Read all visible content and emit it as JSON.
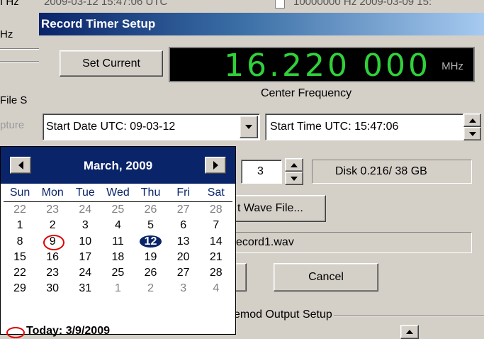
{
  "background": {
    "top_left_text": "I Hz",
    "top_mid_text": "2009-03-12 15:47:06 UTC",
    "top_right_text": "10000000 Hz   2009-03-09 15:",
    "left_labels": [
      "Hz",
      "File S",
      "pture"
    ]
  },
  "dialog": {
    "title": "Record Timer Setup",
    "set_current_label": "Set Current",
    "frequency": {
      "value": "16.220 000",
      "unit": "MHz",
      "caption": "Center Frequency"
    },
    "start_date": "Start Date UTC: 09-03-12",
    "start_time": "Start Time UTC: 15:47:06",
    "duration_value": "3",
    "disk_text": "Disk 0.216/ 38 GB",
    "select_wave_label": "t Wave File...",
    "wave_filename": "ecord1.wav",
    "cancel_label": "Cancel",
    "demod_group_label": "emod Output Setup"
  },
  "calendar": {
    "month_label": "March, 2009",
    "weekdays": [
      "Sun",
      "Mon",
      "Tue",
      "Wed",
      "Thu",
      "Fri",
      "Sat"
    ],
    "weeks": [
      [
        "22",
        "23",
        "24",
        "25",
        "26",
        "27",
        "28"
      ],
      [
        "1",
        "2",
        "3",
        "4",
        "5",
        "6",
        "7"
      ],
      [
        "8",
        "9",
        "10",
        "11",
        "12",
        "13",
        "14"
      ],
      [
        "15",
        "16",
        "17",
        "18",
        "19",
        "20",
        "21"
      ],
      [
        "22",
        "23",
        "24",
        "25",
        "26",
        "27",
        "28"
      ],
      [
        "29",
        "30",
        "31",
        "1",
        "2",
        "3",
        "4"
      ]
    ],
    "selected_day": "12",
    "today_day": "9",
    "today_label": "Today: 3/9/2009"
  },
  "colors": {
    "title_bar": "#0a246a",
    "frequency_digits": "#2fd13a",
    "today_circle": "#e00000"
  }
}
